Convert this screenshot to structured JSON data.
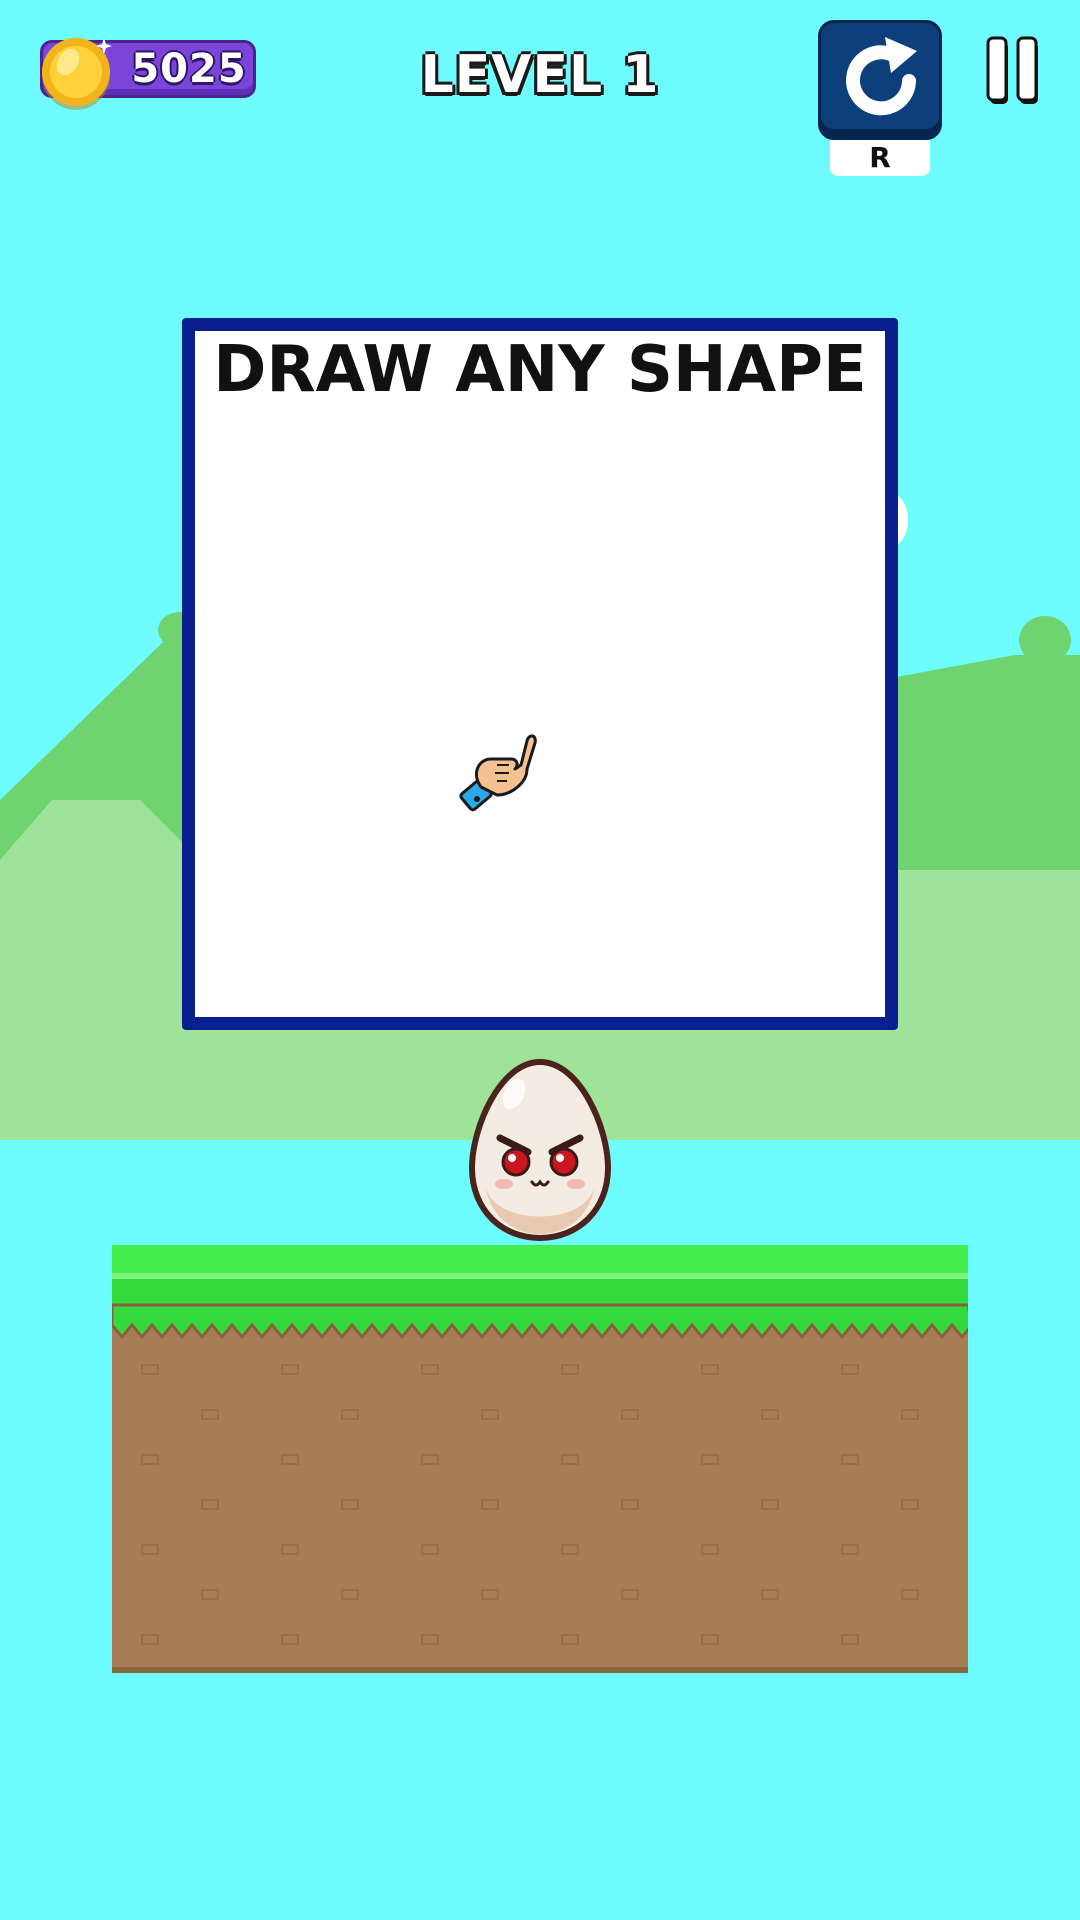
{
  "hud": {
    "coins": "5025",
    "level_title": "LEVEL 1",
    "restart_key_hint": "R"
  },
  "panel": {
    "prompt": "DRAW ANY SHAPE"
  },
  "icons": {
    "coin": "coin-icon",
    "restart": "restart-icon",
    "pause": "pause-icon",
    "hand": "pointing-hand-icon",
    "egg": "angry-egg-character"
  },
  "colors": {
    "sky": "#6ffcff",
    "hills_dark": "#6fd36f",
    "hills_light": "#9fe39a",
    "panel_border": "#0a1f8f",
    "grass": "#43ed4b",
    "dirt": "#a87d55",
    "coin_pill": "#7a45d8",
    "restart_button": "#0d3f7a"
  }
}
